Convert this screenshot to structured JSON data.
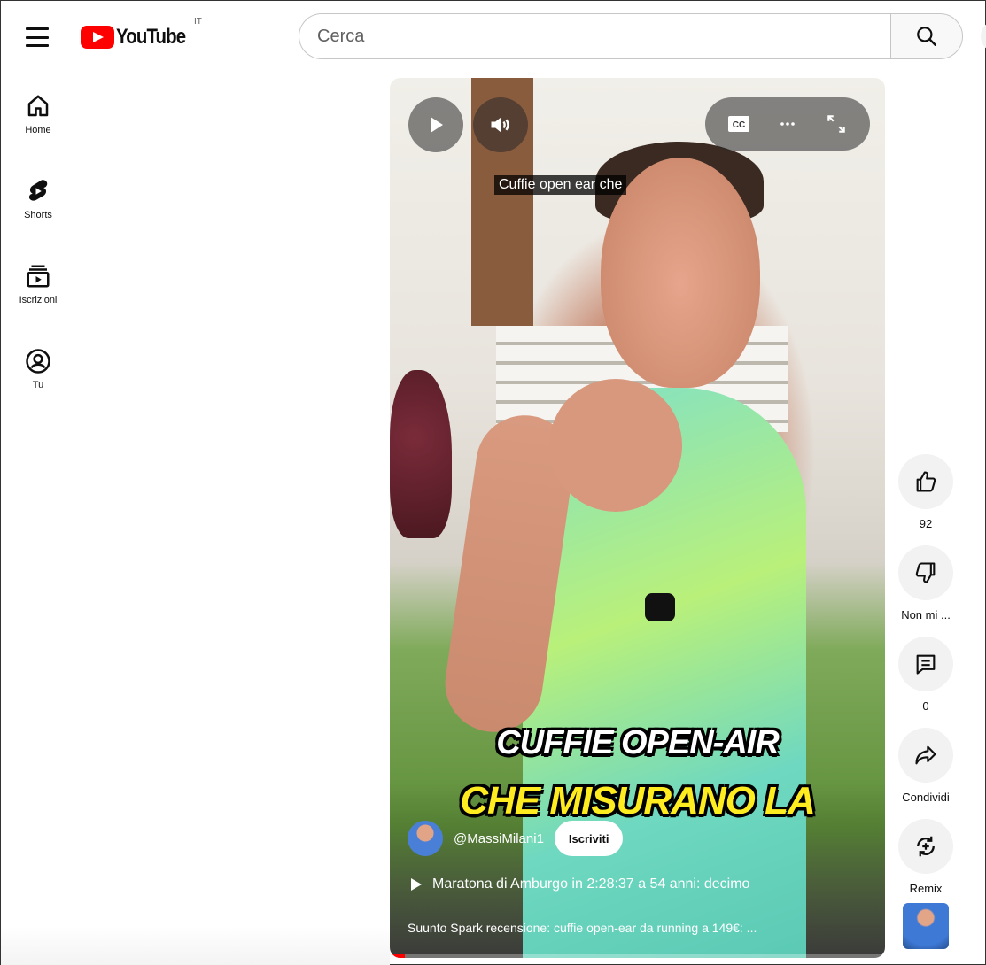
{
  "header": {
    "logo_text": "YouTube",
    "country_code": "IT",
    "search_placeholder": "Cerca"
  },
  "nav": {
    "items": [
      {
        "label": "Home",
        "icon": "home-icon"
      },
      {
        "label": "Shorts",
        "icon": "shorts-icon"
      },
      {
        "label": "Iscrizioni",
        "icon": "subscriptions-icon"
      },
      {
        "label": "Tu",
        "icon": "user-icon"
      }
    ]
  },
  "player": {
    "caption": "Cuffie open ear che",
    "overlay_line1": "CUFFIE OPEN-AIR",
    "overlay_line2": "CHE MISURANO LA",
    "channel_name": "@MassiMilani1",
    "subscribe_label": "Iscriviti",
    "playlist_title": "Maratona di Amburgo in 2:28:37 a 54 anni: decimo",
    "description": "Suunto Spark recensione: cuffie open-ear da running a 149€: ...",
    "progress_fraction": 0.03,
    "overlay_text_color": "#ffec20"
  },
  "actions": {
    "like_count": "92",
    "dislike_label": "Non mi ...",
    "comment_count": "0",
    "share_label": "Condividi",
    "remix_label": "Remix"
  },
  "colors": {
    "brand_red": "#ff0000",
    "action_bg": "#f2f2f2"
  }
}
